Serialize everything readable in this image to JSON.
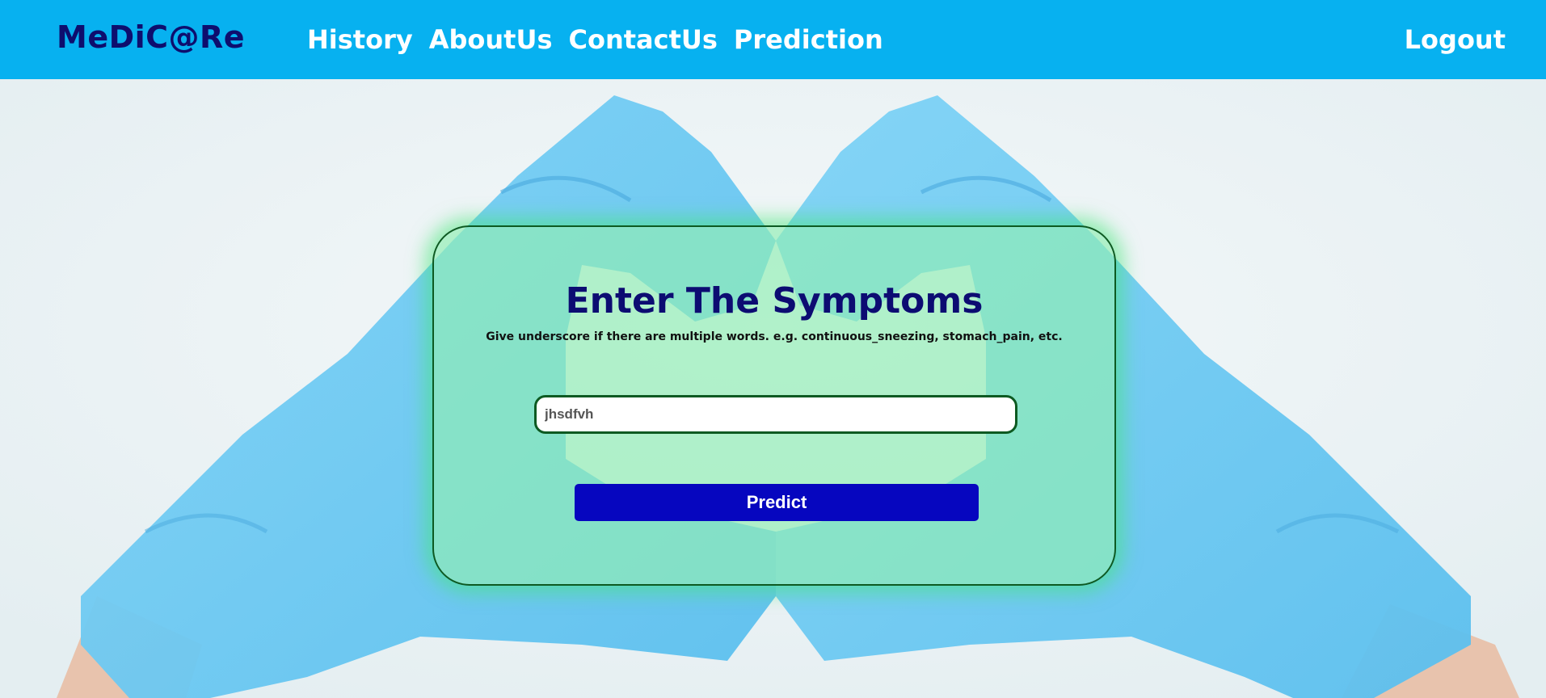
{
  "navbar": {
    "brand": "MeDiC@Re",
    "links": [
      {
        "label": "History"
      },
      {
        "label": "AboutUs"
      },
      {
        "label": "ContactUs"
      },
      {
        "label": "Prediction"
      }
    ],
    "logout_label": "Logout",
    "background_color": "#07b1f0",
    "brand_color": "#0e0e6e"
  },
  "form": {
    "title": "Enter The Symptoms",
    "hint": "Give underscore if there are multiple words. e.g. continuous_sneezing, stomach_pain, etc.",
    "symptom_input": {
      "value": "jhsdfvh",
      "placeholder": ""
    },
    "predict_label": "Predict",
    "button_color": "#0606bf",
    "card_color": "#90eeb4",
    "title_color": "#0c0c72"
  },
  "background": {
    "image": "gloved-hands-heart",
    "glove_color": "#6cc9f2"
  }
}
